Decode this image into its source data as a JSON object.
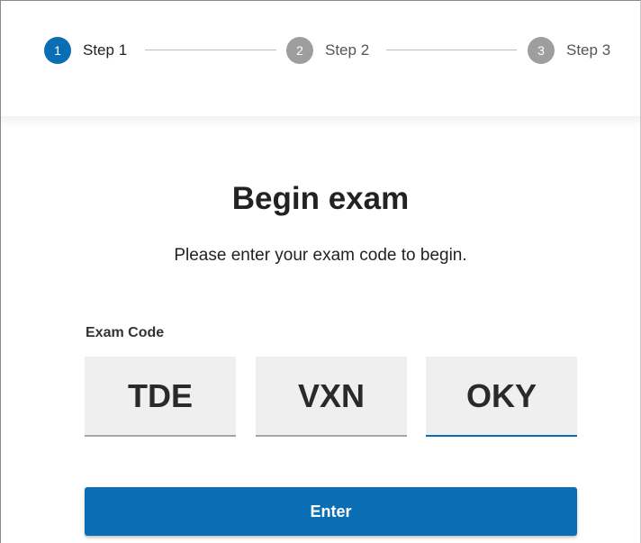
{
  "stepper": {
    "steps": [
      {
        "number": "1",
        "label": "Step 1",
        "state": "active"
      },
      {
        "number": "2",
        "label": "Step 2",
        "state": "inactive"
      },
      {
        "number": "3",
        "label": "Step 3",
        "state": "inactive"
      }
    ]
  },
  "main": {
    "title": "Begin exam",
    "subtitle": "Please enter your exam code to begin.",
    "exam_code": {
      "label": "Exam Code",
      "segments": [
        "TDE",
        "VXN",
        "OKY"
      ]
    },
    "enter_label": "Enter"
  },
  "colors": {
    "accent": "#0a6eb4",
    "inactive_step": "#9e9e9e",
    "input_background": "#efefef"
  }
}
